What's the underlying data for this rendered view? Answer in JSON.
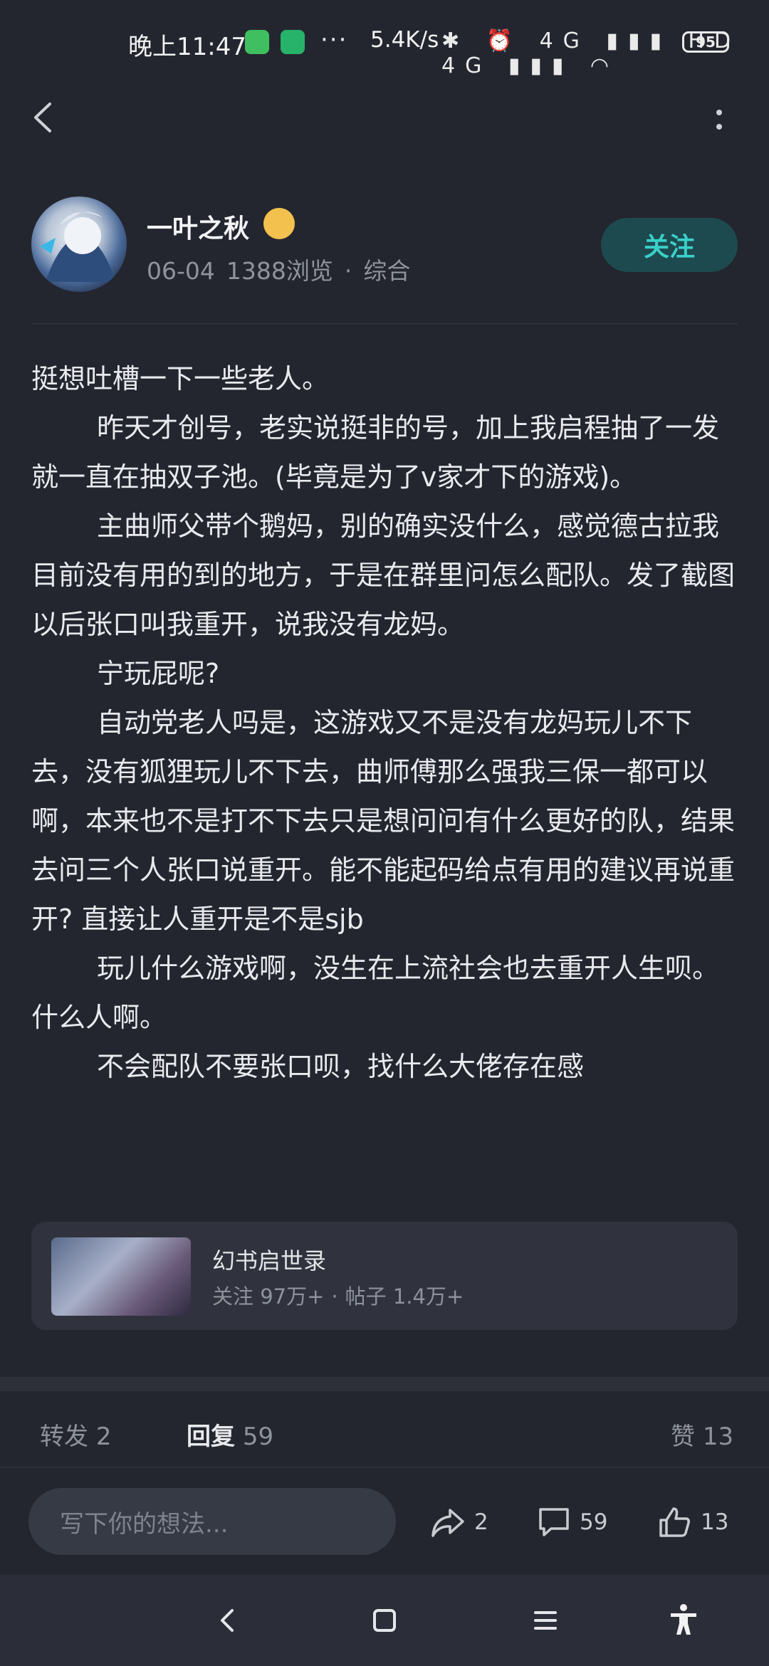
{
  "status_bar": {
    "time": "晚上11:47",
    "dots": "···",
    "net_speed": "5.4K/s",
    "icons": "✱ ⏰ 4G ▮▮▮ HD 4G ▮▮▮ ◠",
    "battery": "95"
  },
  "author": {
    "name": "一叶之秋",
    "date": "06-04",
    "views": "1388浏览",
    "dot": "·",
    "category": "综合",
    "follow_label": "关注"
  },
  "post": {
    "paragraphs": [
      "挺想吐槽一下一些老人。",
      "昨天才创号，老实说挺非的号，加上我启程抽了一发就一直在抽双子池。(毕竟是为了v家才下的游戏)。",
      "主曲师父带个鹅妈，别的确实没什么，感觉德古拉我目前没有用的到的地方，于是在群里问怎么配队。发了截图以后张口叫我重开，说我没有龙妈。",
      "宁玩屁呢?",
      "自动党老人吗是，这游戏又不是没有龙妈玩儿不下去，没有狐狸玩儿不下去，曲师傅那么强我三保一都可以啊，本来也不是打不下去只是想问问有什么更好的队，结果去问三个人张口说重开。能不能起码给点有用的建议再说重开? 直接让人重开是不是sjb",
      "玩儿什么游戏啊，没生在上流社会也去重开人生呗。什么人啊。",
      "不会配队不要张口呗，找什么大佬存在感"
    ]
  },
  "game_card": {
    "title": "幻书启世录",
    "followers": "关注 97万+",
    "dot": "·",
    "posts": "帖子 1.4万+"
  },
  "tabs": {
    "forward_label": "转发",
    "forward_count": "2",
    "reply_label": "回复",
    "reply_count": "59",
    "like_label": "赞",
    "like_count": "13"
  },
  "bottom_bar": {
    "comment_placeholder": "写下你的想法...",
    "share_count": "2",
    "comment_count": "59",
    "like_count": "13"
  }
}
